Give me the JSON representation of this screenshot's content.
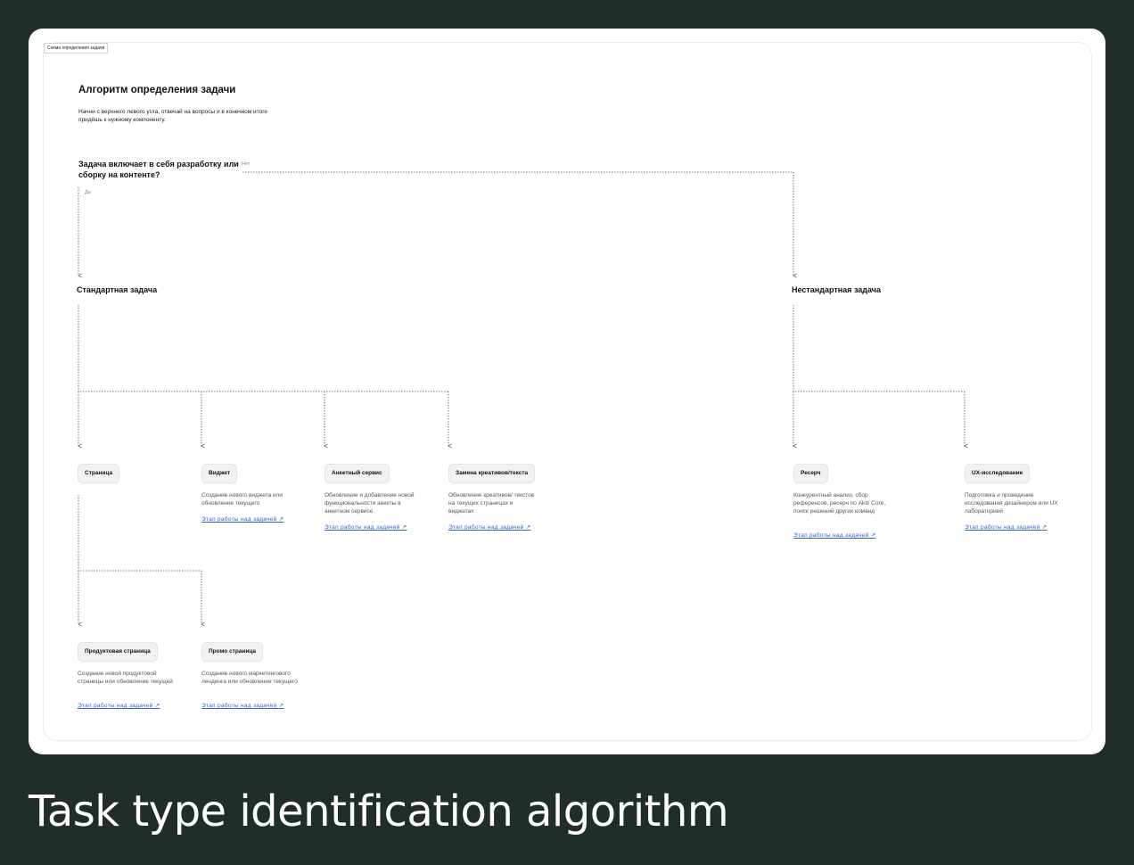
{
  "frame_tag": "Схема определения задачи",
  "title": "Алгоритм определения задачи",
  "subtitle": "Начни с верхнего левого угла, отвечай на вопросы и в конечном итоге придёшь к нужному компоненту.",
  "question": "Задача включает в себя разработку или сборку на контенте?",
  "yes_label": "Да",
  "no_label": "Нет",
  "standard": {
    "title": "Стандартная задача",
    "items": [
      {
        "label": "Страница",
        "desc": "",
        "link": ""
      },
      {
        "label": "Виджет",
        "desc": "Создание нового виджета или обновление текущего",
        "link": "Этап работы над задачей ↗"
      },
      {
        "label": "Анкетный сервис",
        "desc": "Обновление и добавление новой функциональности анкеты в анкетном сервисе",
        "link": "Этап работы над задачей ↗"
      },
      {
        "label": "Замена креативов/текста",
        "desc": "Обновление креативов/ текстов на текущих страницах и виджетах",
        "link": "Этап работы над задачей ↗"
      }
    ],
    "page_children": [
      {
        "label": "Продуктовая страница",
        "desc": "Создание новой продуктовой страницы или обновление текущей",
        "link": "Этап работы над задачей ↗"
      },
      {
        "label": "Промо страница",
        "desc": "Создание нового маркетингового лендинга или обновление текущего",
        "link": "Этап работы над задачей ↗"
      }
    ]
  },
  "nonstandard": {
    "title": "Нестандартная задача",
    "items": [
      {
        "label": "Ресерч",
        "desc": "Конкурентный анализ, сбор референсов, ресерч по Akit/ Core, поиск решений других команд",
        "link": "Этап работы над задачей ↗"
      },
      {
        "label": "UX-исследование",
        "desc": "Подготовка и проведение исследования дизайнером или UX лабораторией",
        "link": "Этап работы над задачей ↗"
      }
    ]
  },
  "caption": "Task type identification algorithm",
  "colors": {
    "background": "#212d2a",
    "card": "#ffffff",
    "link": "#2c61d6",
    "line": "#555555"
  }
}
